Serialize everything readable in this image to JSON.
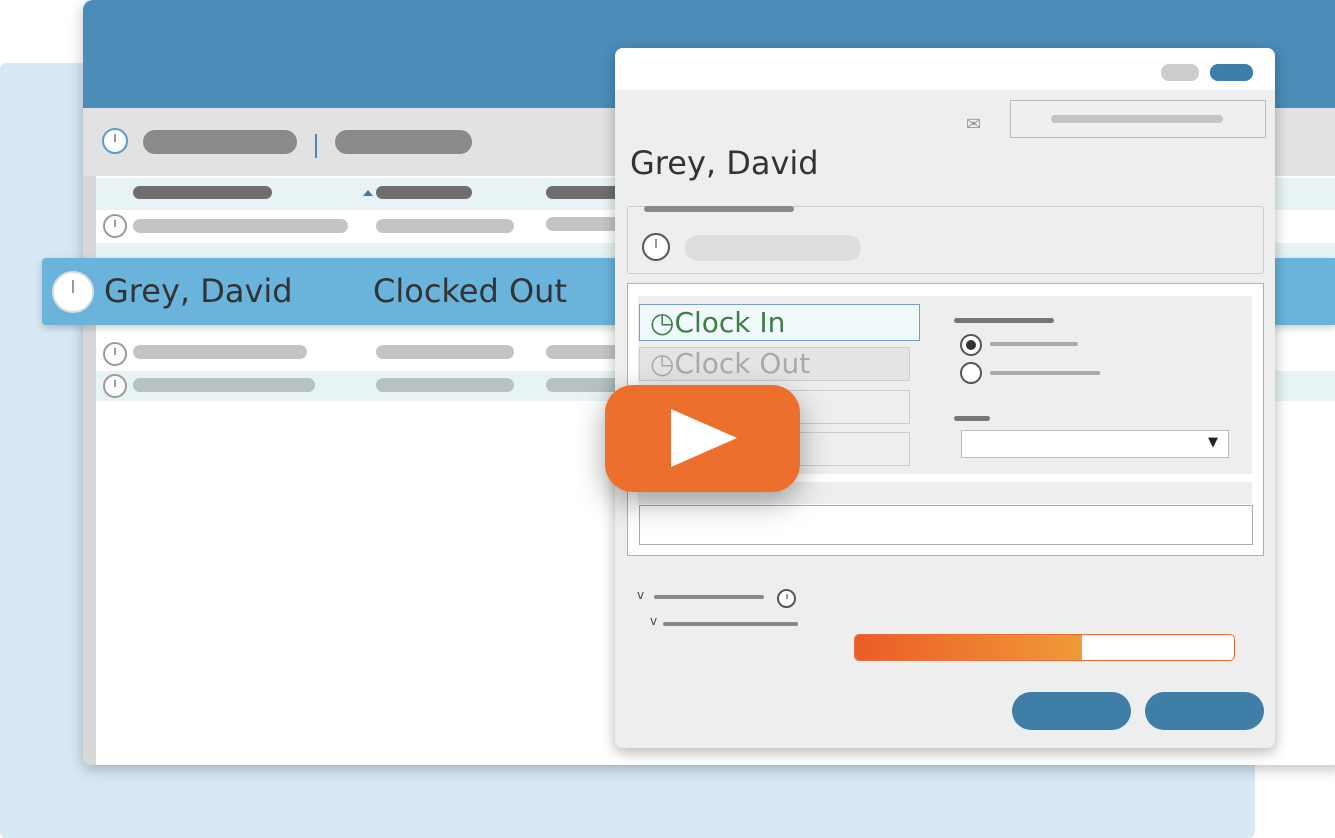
{
  "highlight_row": {
    "name": "Grey, David",
    "status": "Clocked Out"
  },
  "dialog": {
    "title": "Grey, David",
    "clock_in_label": "Clock In",
    "clock_out_label": "Clock Out",
    "progress_percent": 60
  },
  "colors": {
    "brand_blue": "#4a8db8",
    "highlight": "#6ab4dc",
    "play": "#ec6f2d",
    "clock_in_green": "#3f7d45"
  },
  "icons": [
    "clock-icon",
    "envelope-icon",
    "play-icon",
    "chevron-down-icon",
    "radio-selected",
    "radio-unselected"
  ]
}
